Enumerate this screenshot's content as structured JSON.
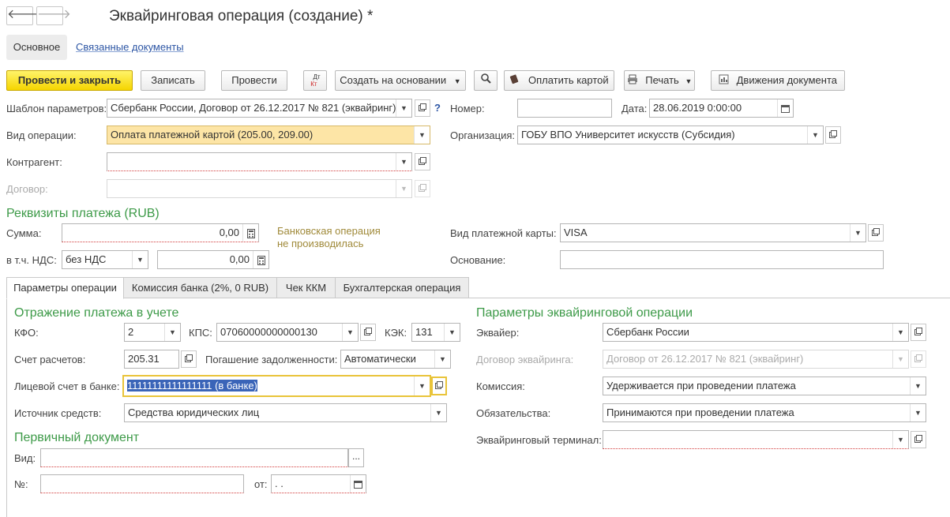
{
  "window": {
    "title": "Эквайринговая операция (создание) *"
  },
  "nav": {
    "back_glyph": "🡐",
    "forward_glyph": "🡒"
  },
  "top_tabs": {
    "main": "Основное",
    "related": "Связанные документы"
  },
  "toolbar": {
    "post_and_close": "Провести и закрыть",
    "save": "Записать",
    "post": "Провести",
    "dtkt_top": "Дт",
    "dtkt_bottom": "Кт",
    "create_based": "Создать на основании",
    "pay_card": "Оплатить картой",
    "print": "Печать",
    "movements": "Движения документа"
  },
  "header": {
    "template_label": "Шаблон параметров:",
    "template_value": "Сбербанк России, Договор от 26.12.2017 № 821 (эквайринг)",
    "help_glyph": "?",
    "number_label": "Номер:",
    "number_value": "",
    "date_label": "Дата:",
    "date_value": "28.06.2019  0:00:00",
    "op_type_label": "Вид операции:",
    "op_type_value": "Оплата платежной картой (205.00, 209.00)",
    "org_label": "Организация:",
    "org_value": "ГОБУ ВПО Университет искусств (Субсидия)",
    "counterparty_label": "Контрагент:",
    "counterparty_value": "",
    "contract_label": "Договор:",
    "contract_value": ""
  },
  "payment": {
    "section_title": "Реквизиты платежа (RUB)",
    "sum_label": "Сумма:",
    "sum_value": "0,00",
    "vat_label": "в т.ч. НДС:",
    "vat_rate": "без НДС",
    "vat_value": "0,00",
    "note_line1": "Банковская операция",
    "note_line2": "не производилась",
    "card_type_label": "Вид платежной карты:",
    "card_type_value": "VISA",
    "basis_label": "Основание:",
    "basis_value": ""
  },
  "tabs": [
    {
      "label": "Параметры операции"
    },
    {
      "label": "Комиссия банка (2%, 0 RUB)"
    },
    {
      "label": "Чек ККМ"
    },
    {
      "label": "Бухгалтерская операция"
    }
  ],
  "reflection": {
    "section_title": "Отражение платежа в учете",
    "kfo_label": "КФО:",
    "kfo_value": "2",
    "kps_label": "КПС:",
    "kps_value": "07060000000000130",
    "kek_label": "КЭК:",
    "kek_value": "131",
    "account_label": "Счет расчетов:",
    "account_value": "205.31",
    "debt_label": "Погашение задолженности:",
    "debt_value": "Автоматически",
    "personal_acc_label": "Лицевой счет в банке:",
    "personal_acc_value": "11111111111111111 (в банке)",
    "source_label": "Источник средств:",
    "source_value": "Средства юридических лиц"
  },
  "primary_doc": {
    "section_title": "Первичный документ",
    "kind_label": "Вид:",
    "kind_value": "",
    "ellipsis": "...",
    "num_label": "№:",
    "num_value": "",
    "from_label": "от:",
    "from_value": " .  .  "
  },
  "acquiring": {
    "section_title": "Параметры эквайринговой операции",
    "acquirer_label": "Эквайер:",
    "acquirer_value": "Сбербанк России",
    "contract_label": "Договор эквайринга:",
    "contract_value": "Договор от 26.12.2017 № 821 (эквайринг)",
    "commission_label": "Комиссия:",
    "commission_value": "Удерживается при проведении платежа",
    "obligations_label": "Обязательства:",
    "obligations_value": "Принимаются при проведении платежа",
    "terminal_label": "Эквайринговый терминал:",
    "terminal_value": ""
  }
}
